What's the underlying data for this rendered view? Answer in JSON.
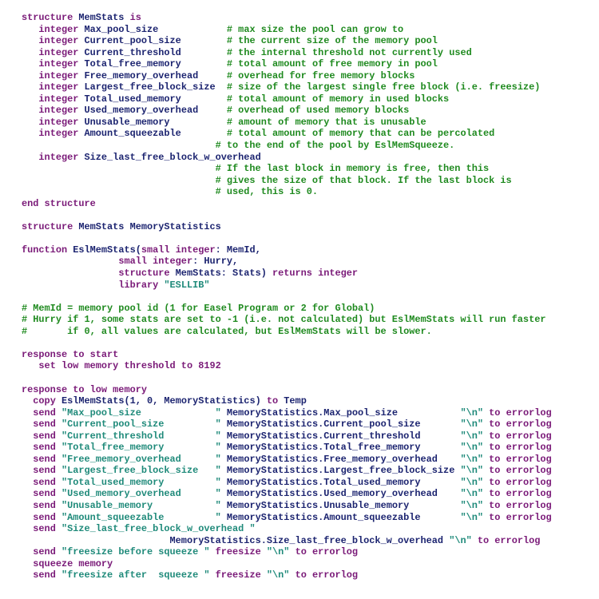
{
  "document": {
    "type": "source-code listing",
    "colors": {
      "keyword": "#7a1a78",
      "identifier": "#1c2470",
      "comment": "#1f8a1f",
      "string": "#1f8a7a"
    },
    "lines": [
      [
        [
          "kw",
          "structure "
        ],
        [
          "id",
          "MemStats "
        ],
        [
          "kw",
          "is"
        ]
      ],
      [
        [
          "pl",
          "   "
        ],
        [
          "kw",
          "integer "
        ],
        [
          "id",
          "Max_pool_size            "
        ],
        [
          "cm",
          "# max size the pool can grow to"
        ]
      ],
      [
        [
          "pl",
          "   "
        ],
        [
          "kw",
          "integer "
        ],
        [
          "id",
          "Current_pool_size        "
        ],
        [
          "cm",
          "# the current size of the memory pool"
        ]
      ],
      [
        [
          "pl",
          "   "
        ],
        [
          "kw",
          "integer "
        ],
        [
          "id",
          "Current_threshold        "
        ],
        [
          "cm",
          "# the internal threshold not currently used"
        ]
      ],
      [
        [
          "pl",
          "   "
        ],
        [
          "kw",
          "integer "
        ],
        [
          "id",
          "Total_free_memory        "
        ],
        [
          "cm",
          "# total amount of free memory in pool"
        ]
      ],
      [
        [
          "pl",
          "   "
        ],
        [
          "kw",
          "integer "
        ],
        [
          "id",
          "Free_memory_overhead     "
        ],
        [
          "cm",
          "# overhead for free memory blocks"
        ]
      ],
      [
        [
          "pl",
          "   "
        ],
        [
          "kw",
          "integer "
        ],
        [
          "id",
          "Largest_free_block_size  "
        ],
        [
          "cm",
          "# size of the largest single free block (i.e. freesize)"
        ]
      ],
      [
        [
          "pl",
          "   "
        ],
        [
          "kw",
          "integer "
        ],
        [
          "id",
          "Total_used_memory        "
        ],
        [
          "cm",
          "# total amount of memory in used blocks"
        ]
      ],
      [
        [
          "pl",
          "   "
        ],
        [
          "kw",
          "integer "
        ],
        [
          "id",
          "Used_memory_overhead     "
        ],
        [
          "cm",
          "# overhead of used memory blocks"
        ]
      ],
      [
        [
          "pl",
          "   "
        ],
        [
          "kw",
          "integer "
        ],
        [
          "id",
          "Unusable_memory          "
        ],
        [
          "cm",
          "# amount of memory that is unusable"
        ]
      ],
      [
        [
          "pl",
          "   "
        ],
        [
          "kw",
          "integer "
        ],
        [
          "id",
          "Amount_squeezable        "
        ],
        [
          "cm",
          "# total amount of memory that can be percolated"
        ]
      ],
      [
        [
          "pl",
          "                                  "
        ],
        [
          "cm",
          "# to the end of the pool by EslMemSqueeze."
        ]
      ],
      [
        [
          "pl",
          "   "
        ],
        [
          "kw",
          "integer "
        ],
        [
          "id",
          "Size_last_free_block_w_overhead"
        ]
      ],
      [
        [
          "pl",
          "                                  "
        ],
        [
          "cm",
          "# If the last block in memory is free, then this"
        ]
      ],
      [
        [
          "pl",
          "                                  "
        ],
        [
          "cm",
          "# gives the size of that block. If the last block is"
        ]
      ],
      [
        [
          "pl",
          "                                  "
        ],
        [
          "cm",
          "# used, this is 0."
        ]
      ],
      [
        [
          "kw",
          "end structure"
        ]
      ],
      [],
      [
        [
          "kw",
          "structure "
        ],
        [
          "id",
          "MemStats MemoryStatistics"
        ]
      ],
      [],
      [
        [
          "kw",
          "function "
        ],
        [
          "id",
          "EslMemStats("
        ],
        [
          "kw",
          "small integer"
        ],
        [
          "id",
          ": MemId,"
        ]
      ],
      [
        [
          "pl",
          "                 "
        ],
        [
          "kw",
          "small integer"
        ],
        [
          "id",
          ": Hurry,"
        ]
      ],
      [
        [
          "pl",
          "                 "
        ],
        [
          "kw",
          "structure "
        ],
        [
          "id",
          "MemStats: Stats) "
        ],
        [
          "kw",
          "returns integer"
        ]
      ],
      [
        [
          "pl",
          "                 "
        ],
        [
          "kw",
          "library "
        ],
        [
          "str",
          "\"ESLLIB\""
        ]
      ],
      [],
      [
        [
          "cm",
          "# MemId = memory pool id (1 for Easel Program or 2 for Global)"
        ]
      ],
      [
        [
          "cm",
          "# Hurry if 1, some stats are set to -1 (i.e. not calculated) but EslMemStats will run faster"
        ]
      ],
      [
        [
          "cm",
          "#       if 0, all values are calculated, but EslMemStats will be slower."
        ]
      ],
      [],
      [
        [
          "kw",
          "response to start"
        ]
      ],
      [
        [
          "pl",
          "   "
        ],
        [
          "kw",
          "set low memory threshold to 8192"
        ]
      ],
      [],
      [
        [
          "kw",
          "response to low memory"
        ]
      ],
      [
        [
          "pl",
          "  "
        ],
        [
          "kw",
          "copy "
        ],
        [
          "id",
          "EslMemStats(1, 0, MemoryStatistics) "
        ],
        [
          "kw",
          "to "
        ],
        [
          "id",
          "Temp"
        ]
      ],
      [
        [
          "pl",
          "  "
        ],
        [
          "kw",
          "send "
        ],
        [
          "str",
          "\"Max_pool_size             \" "
        ],
        [
          "id",
          "MemoryStatistics.Max_pool_size           "
        ],
        [
          "str",
          "\"\\n\" "
        ],
        [
          "kw",
          "to errorlog"
        ]
      ],
      [
        [
          "pl",
          "  "
        ],
        [
          "kw",
          "send "
        ],
        [
          "str",
          "\"Current_pool_size         \" "
        ],
        [
          "id",
          "MemoryStatistics.Current_pool_size       "
        ],
        [
          "str",
          "\"\\n\" "
        ],
        [
          "kw",
          "to errorlog"
        ]
      ],
      [
        [
          "pl",
          "  "
        ],
        [
          "kw",
          "send "
        ],
        [
          "str",
          "\"Current_threshold         \" "
        ],
        [
          "id",
          "MemoryStatistics.Current_threshold       "
        ],
        [
          "str",
          "\"\\n\" "
        ],
        [
          "kw",
          "to errorlog"
        ]
      ],
      [
        [
          "pl",
          "  "
        ],
        [
          "kw",
          "send "
        ],
        [
          "str",
          "\"Total_free_memory         \" "
        ],
        [
          "id",
          "MemoryStatistics.Total_free_memory       "
        ],
        [
          "str",
          "\"\\n\" "
        ],
        [
          "kw",
          "to errorlog"
        ]
      ],
      [
        [
          "pl",
          "  "
        ],
        [
          "kw",
          "send "
        ],
        [
          "str",
          "\"Free_memory_overhead      \" "
        ],
        [
          "id",
          "MemoryStatistics.Free_memory_overhead    "
        ],
        [
          "str",
          "\"\\n\" "
        ],
        [
          "kw",
          "to errorlog"
        ]
      ],
      [
        [
          "pl",
          "  "
        ],
        [
          "kw",
          "send "
        ],
        [
          "str",
          "\"Largest_free_block_size   \" "
        ],
        [
          "id",
          "MemoryStatistics.Largest_free_block_size "
        ],
        [
          "str",
          "\"\\n\" "
        ],
        [
          "kw",
          "to errorlog"
        ]
      ],
      [
        [
          "pl",
          "  "
        ],
        [
          "kw",
          "send "
        ],
        [
          "str",
          "\"Total_used_memory         \" "
        ],
        [
          "id",
          "MemoryStatistics.Total_used_memory       "
        ],
        [
          "str",
          "\"\\n\" "
        ],
        [
          "kw",
          "to errorlog"
        ]
      ],
      [
        [
          "pl",
          "  "
        ],
        [
          "kw",
          "send "
        ],
        [
          "str",
          "\"Used_memory_overhead      \" "
        ],
        [
          "id",
          "MemoryStatistics.Used_memory_overhead    "
        ],
        [
          "str",
          "\"\\n\" "
        ],
        [
          "kw",
          "to errorlog"
        ]
      ],
      [
        [
          "pl",
          "  "
        ],
        [
          "kw",
          "send "
        ],
        [
          "str",
          "\"Unusable_memory           \" "
        ],
        [
          "id",
          "MemoryStatistics.Unusable_memory         "
        ],
        [
          "str",
          "\"\\n\" "
        ],
        [
          "kw",
          "to errorlog"
        ]
      ],
      [
        [
          "pl",
          "  "
        ],
        [
          "kw",
          "send "
        ],
        [
          "str",
          "\"Amount_squeezable         \" "
        ],
        [
          "id",
          "MemoryStatistics.Amount_squeezable       "
        ],
        [
          "str",
          "\"\\n\" "
        ],
        [
          "kw",
          "to errorlog"
        ]
      ],
      [
        [
          "pl",
          "  "
        ],
        [
          "kw",
          "send "
        ],
        [
          "str",
          "\"Size_last_free_block_w_overhead \""
        ]
      ],
      [
        [
          "pl",
          "                          "
        ],
        [
          "id",
          "MemoryStatistics.Size_last_free_block_w_overhead "
        ],
        [
          "str",
          "\"\\n\" "
        ],
        [
          "kw",
          "to errorlog"
        ]
      ],
      [
        [
          "pl",
          "  "
        ],
        [
          "kw",
          "send "
        ],
        [
          "str",
          "\"freesize before squeeze \" "
        ],
        [
          "kw",
          "freesize "
        ],
        [
          "str",
          "\"\\n\" "
        ],
        [
          "kw",
          "to errorlog"
        ]
      ],
      [
        [
          "pl",
          "  "
        ],
        [
          "kw",
          "squeeze memory"
        ]
      ],
      [
        [
          "pl",
          "  "
        ],
        [
          "kw",
          "send "
        ],
        [
          "str",
          "\"freesize after  squeeze \" "
        ],
        [
          "kw",
          "freesize "
        ],
        [
          "str",
          "\"\\n\" "
        ],
        [
          "kw",
          "to errorlog"
        ]
      ]
    ]
  }
}
